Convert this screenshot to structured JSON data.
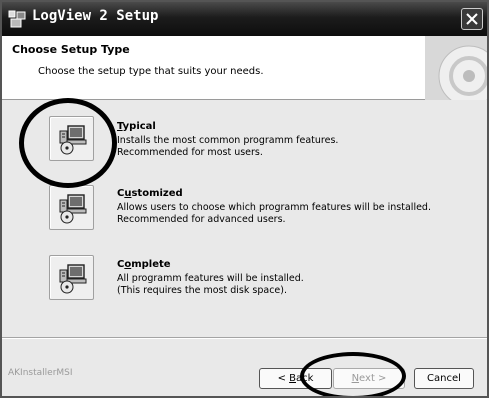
{
  "window": {
    "title": "LogView 2 Setup",
    "icons": {
      "title": "setup-icon",
      "close": "close-icon"
    }
  },
  "header": {
    "title": "Choose Setup Type",
    "subtitle": "Choose the setup type that suits your needs."
  },
  "options": [
    {
      "accesskey": "T",
      "title_rest": "ypical",
      "desc1": "Installs the most common programm features.",
      "desc2": "Recommended for most users.",
      "icon": "computer-install-icon"
    },
    {
      "accesskey": "u",
      "title_first": "C",
      "title_rest": "stomized",
      "desc1": "Allows users to choose which programm features will be installed.",
      "desc2": "Recommended for advanced users.",
      "icon": "computer-install-icon"
    },
    {
      "accesskey": "o",
      "title_first": "C",
      "title_rest": "mplete",
      "desc1": "All programm features will be installed.",
      "desc2": "(This requires the most disk space).",
      "icon": "computer-install-icon"
    }
  ],
  "footer": {
    "brand": "AKInstallerMSI",
    "back_pre": "< ",
    "back_key": "B",
    "back_rest": "ack",
    "next_key": "N",
    "next_rest": "ext >",
    "cancel": "Cancel"
  }
}
